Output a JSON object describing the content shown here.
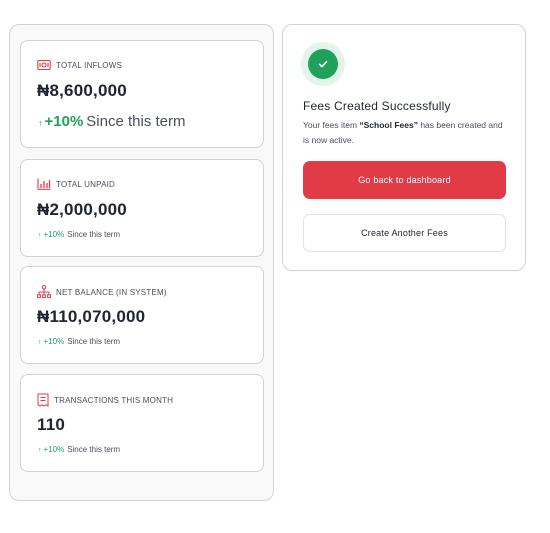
{
  "stats": [
    {
      "label": "TOTAL INFLOWS",
      "icon": "money-icon",
      "value": "₦8,600,000",
      "change_pct": "+10%",
      "change_text": "Since this term"
    },
    {
      "label": "TOTAL UNPAID",
      "icon": "bar-chart-icon",
      "value": "₦2,000,000",
      "change_pct": "+10%",
      "change_text": "Since this term"
    },
    {
      "label": "NET BALANCE (IN SYSTEM)",
      "icon": "hierarchy-icon",
      "value": "₦110,070,000",
      "change_pct": "+10%",
      "change_text": "Since this term"
    },
    {
      "label": "TRANSACTIONS THIS MONTH",
      "icon": "receipt-icon",
      "value": "110",
      "change_pct": "+10%",
      "change_text": "Since this term"
    }
  ],
  "success": {
    "title": "Fees Created Successfully",
    "message_prefix": "Your fees item ",
    "item_name": "“School Fees”",
    "message_suffix": " has been created and is now active.",
    "primary_button": "Go back to dashboard",
    "secondary_button": "Create Another Fees"
  },
  "colors": {
    "accent": "#e03b47",
    "success": "#1fa15c",
    "up": "#1fa15c"
  }
}
